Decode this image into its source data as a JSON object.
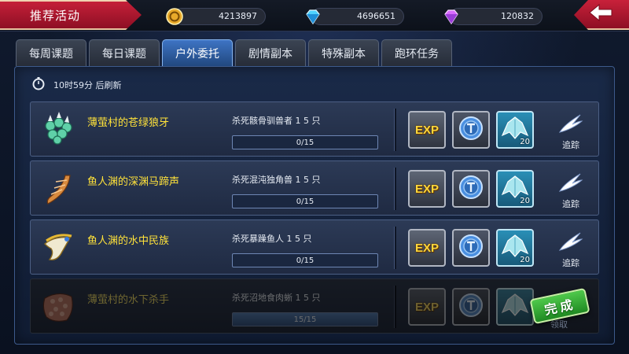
{
  "header": {
    "title": "推荐活动",
    "currencies": [
      {
        "icon": "gold-coin-icon",
        "value": "4213897"
      },
      {
        "icon": "blue-diamond-icon",
        "value": "4696651"
      },
      {
        "icon": "purple-gem-icon",
        "value": "120832"
      }
    ],
    "back_icon": "back-arrow-icon"
  },
  "tabs": [
    {
      "label": "每周课题",
      "active": false
    },
    {
      "label": "每日课题",
      "active": false
    },
    {
      "label": "户外委托",
      "active": true
    },
    {
      "label": "剧情副本",
      "active": false
    },
    {
      "label": "特殊副本",
      "active": false
    },
    {
      "label": "跑环任务",
      "active": false
    }
  ],
  "refresh": {
    "icon": "stopwatch-icon",
    "text": "10时59分 后刷新"
  },
  "quests": [
    {
      "name": "薄萤村的苍绿狼牙",
      "task": "杀死骸骨驯兽者 1 5 只",
      "progress": "0/15",
      "progress_fraction": 0,
      "icon": "green-claw-item-icon",
      "rewards": {
        "exp": "EXP",
        "cloak_qty": "20"
      },
      "action": "追踪",
      "completed": false
    },
    {
      "name": "鱼人渊的深渊马蹄声",
      "task": "杀死混沌独角兽 1 5 只",
      "progress": "0/15",
      "progress_fraction": 0,
      "icon": "horn-item-icon",
      "rewards": {
        "exp": "EXP",
        "cloak_qty": "20"
      },
      "action": "追踪",
      "completed": false
    },
    {
      "name": "鱼人渊的水中民族",
      "task": "杀死暴躁鱼人 1 5 只",
      "progress": "0/15",
      "progress_fraction": 0,
      "icon": "horn-cup-item-icon",
      "rewards": {
        "exp": "EXP",
        "cloak_qty": "20"
      },
      "action": "追踪",
      "completed": false
    },
    {
      "name": "薄萤村的水下杀手",
      "task": "杀死沼地食肉蜥 1 5 只",
      "progress": "15/15",
      "progress_fraction": 1,
      "icon": "scale-hide-item-icon",
      "rewards": {
        "exp": "EXP",
        "cloak_qty": ""
      },
      "action": "领取",
      "completed": true,
      "badge": "完成"
    }
  ],
  "colors": {
    "quest_name": "#ffe23a",
    "accent_red": "#c8213a",
    "active_tab": "#3e74c4",
    "complete_green": "#1f8a22"
  }
}
